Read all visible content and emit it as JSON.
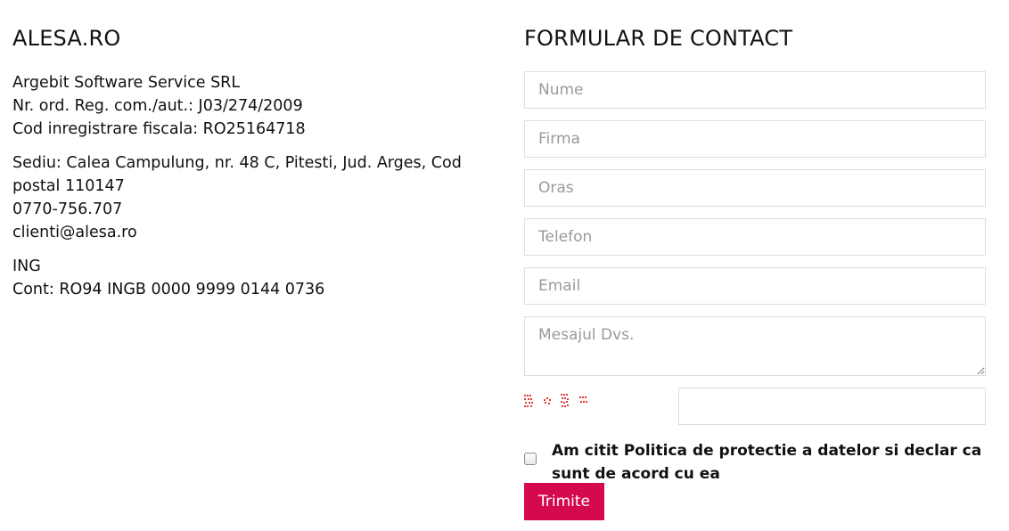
{
  "company": {
    "title": "ALESA.RO",
    "name": "Argebit Software Service SRL",
    "reg": "Nr. ord. Reg. com./aut.: J03/274/2009",
    "fiscal": "Cod inregistrare fiscala: RO25164718",
    "address": "Sediu: Calea Campulung, nr. 48 C, Pitesti, Jud. Arges, Cod postal 110147",
    "phone": "0770-756.707",
    "email": "clienti@alesa.ro",
    "bank": "ING",
    "account": "Cont: RO94 INGB 0000 9999 0144 0736"
  },
  "form": {
    "title": "FORMULAR DE CONTACT",
    "name_placeholder": "Nume",
    "company_placeholder": "Firma",
    "city_placeholder": "Oras",
    "phone_placeholder": "Telefon",
    "email_placeholder": "Email",
    "message_placeholder": "Mesajul Dvs.",
    "captcha_value": "",
    "consent_label": "Am citit Politica de protectie a datelor si declar ca sunt de acord cu ea",
    "consent_checked": false,
    "submit_label": "Trimite"
  },
  "colors": {
    "accent": "#d5094e",
    "captcha": "#e03a3a"
  },
  "icons": {
    "captcha": "captcha-image"
  }
}
